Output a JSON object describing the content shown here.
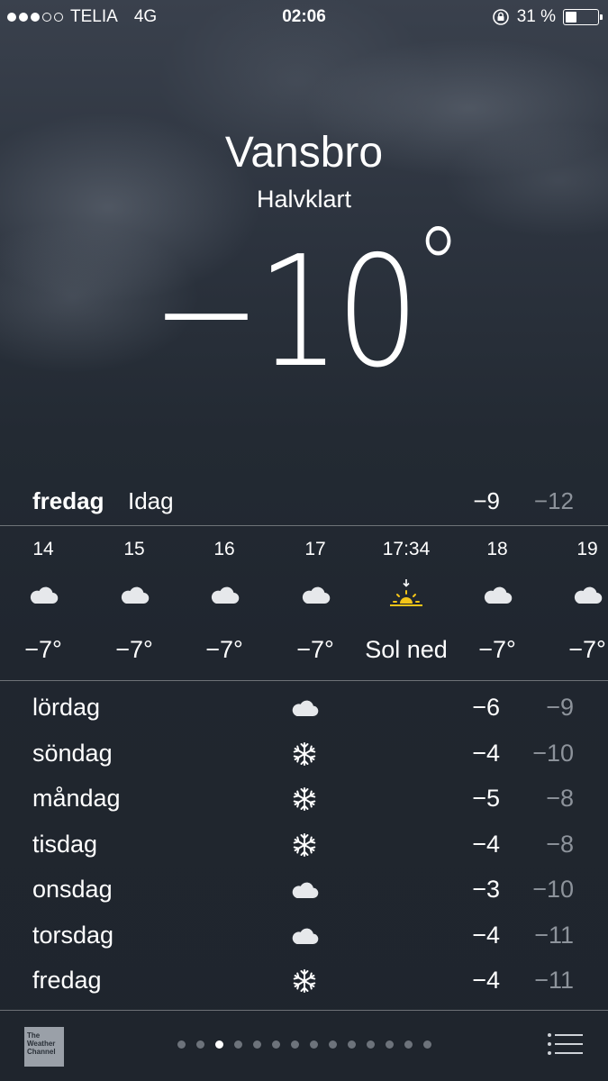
{
  "status": {
    "carrier": "TELIA",
    "network": "4G",
    "time": "02:06",
    "battery": "31 %",
    "signal_bars": 3,
    "signal_total": 5
  },
  "location": {
    "city": "Vansbro",
    "condition": "Halvklart",
    "temperature": "−10",
    "degree": "°"
  },
  "today": {
    "day": "fredag",
    "label": "Idag",
    "high": "−9",
    "low": "−12"
  },
  "hourly": [
    {
      "time": "14",
      "icon": "cloud-icon",
      "temp": "−7°"
    },
    {
      "time": "15",
      "icon": "cloud-icon",
      "temp": "−7°"
    },
    {
      "time": "16",
      "icon": "cloud-icon",
      "temp": "−7°"
    },
    {
      "time": "17",
      "icon": "cloud-icon",
      "temp": "−7°"
    },
    {
      "time": "17:34",
      "icon": "sunset-icon",
      "temp": "Sol ned"
    },
    {
      "time": "18",
      "icon": "cloud-icon",
      "temp": "−7°"
    },
    {
      "time": "19",
      "icon": "cloud-icon",
      "temp": "−7°"
    }
  ],
  "daily": [
    {
      "day": "lördag",
      "icon": "cloud-icon",
      "high": "−6",
      "low": "−9"
    },
    {
      "day": "söndag",
      "icon": "snowflake-icon",
      "high": "−4",
      "low": "−10"
    },
    {
      "day": "måndag",
      "icon": "snowflake-icon",
      "high": "−5",
      "low": "−8"
    },
    {
      "day": "tisdag",
      "icon": "snowflake-icon",
      "high": "−4",
      "low": "−8"
    },
    {
      "day": "onsdag",
      "icon": "cloud-icon",
      "high": "−3",
      "low": "−10"
    },
    {
      "day": "torsdag",
      "icon": "cloud-icon",
      "high": "−4",
      "low": "−11"
    },
    {
      "day": "fredag",
      "icon": "snowflake-icon",
      "high": "−4",
      "low": "−11"
    }
  ],
  "footer": {
    "logo_text": "The Weather Channel",
    "page_count": 14,
    "active_page": 3
  },
  "colors": {
    "sun": "#f5c518",
    "low_temp": "#8d939b"
  }
}
